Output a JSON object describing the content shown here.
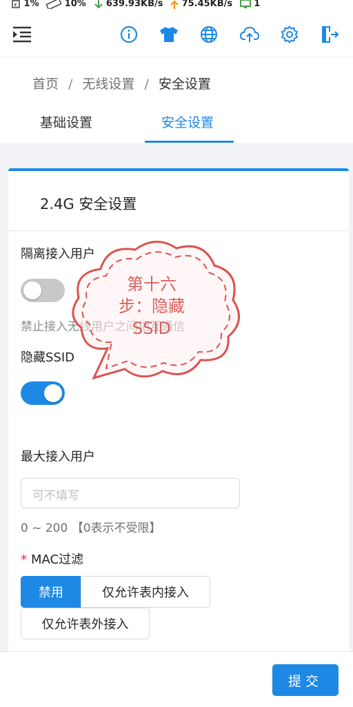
{
  "status": {
    "cpu": "1%",
    "mem": "10%",
    "down": "639.93KB/s",
    "up": "75.45KB/s",
    "clients": "1"
  },
  "topbar": {
    "icons": [
      "menu-icon",
      "info-icon",
      "shirt-icon",
      "globe-icon",
      "upload-cloud-icon",
      "gear-icon",
      "logout-icon"
    ]
  },
  "breadcrumb": {
    "home": "首页",
    "sep1": "/",
    "mid": "无线设置",
    "sep2": "/",
    "current": "安全设置"
  },
  "tabs": [
    {
      "label": "基础设置"
    },
    {
      "label": "安全设置",
      "active": true
    }
  ],
  "card": {
    "title": "2.4G 安全设置"
  },
  "isolation": {
    "label": "隔离接入用户",
    "help": "禁止接入无线用户之间相互通信",
    "on": false
  },
  "hide_ssid": {
    "label": "隐藏SSID",
    "on": true
  },
  "max_users": {
    "label": "最大接入用户",
    "placeholder": "可不填写",
    "hint": "0 ~ 200 【0表示不受限】"
  },
  "mac_filter": {
    "required_mark": "*",
    "label": "MAC过滤",
    "options": [
      {
        "label": "禁用",
        "active": true
      },
      {
        "label": "仅允许表内接入"
      },
      {
        "label": "仅允许表外接入"
      }
    ]
  },
  "footer": {
    "submit": "提交"
  },
  "annotation": {
    "line1": "第十六",
    "line2": "步：隐藏",
    "line3": "SSID"
  },
  "colors": {
    "accent": "#1e88e5",
    "stamp": "#d9534f"
  }
}
